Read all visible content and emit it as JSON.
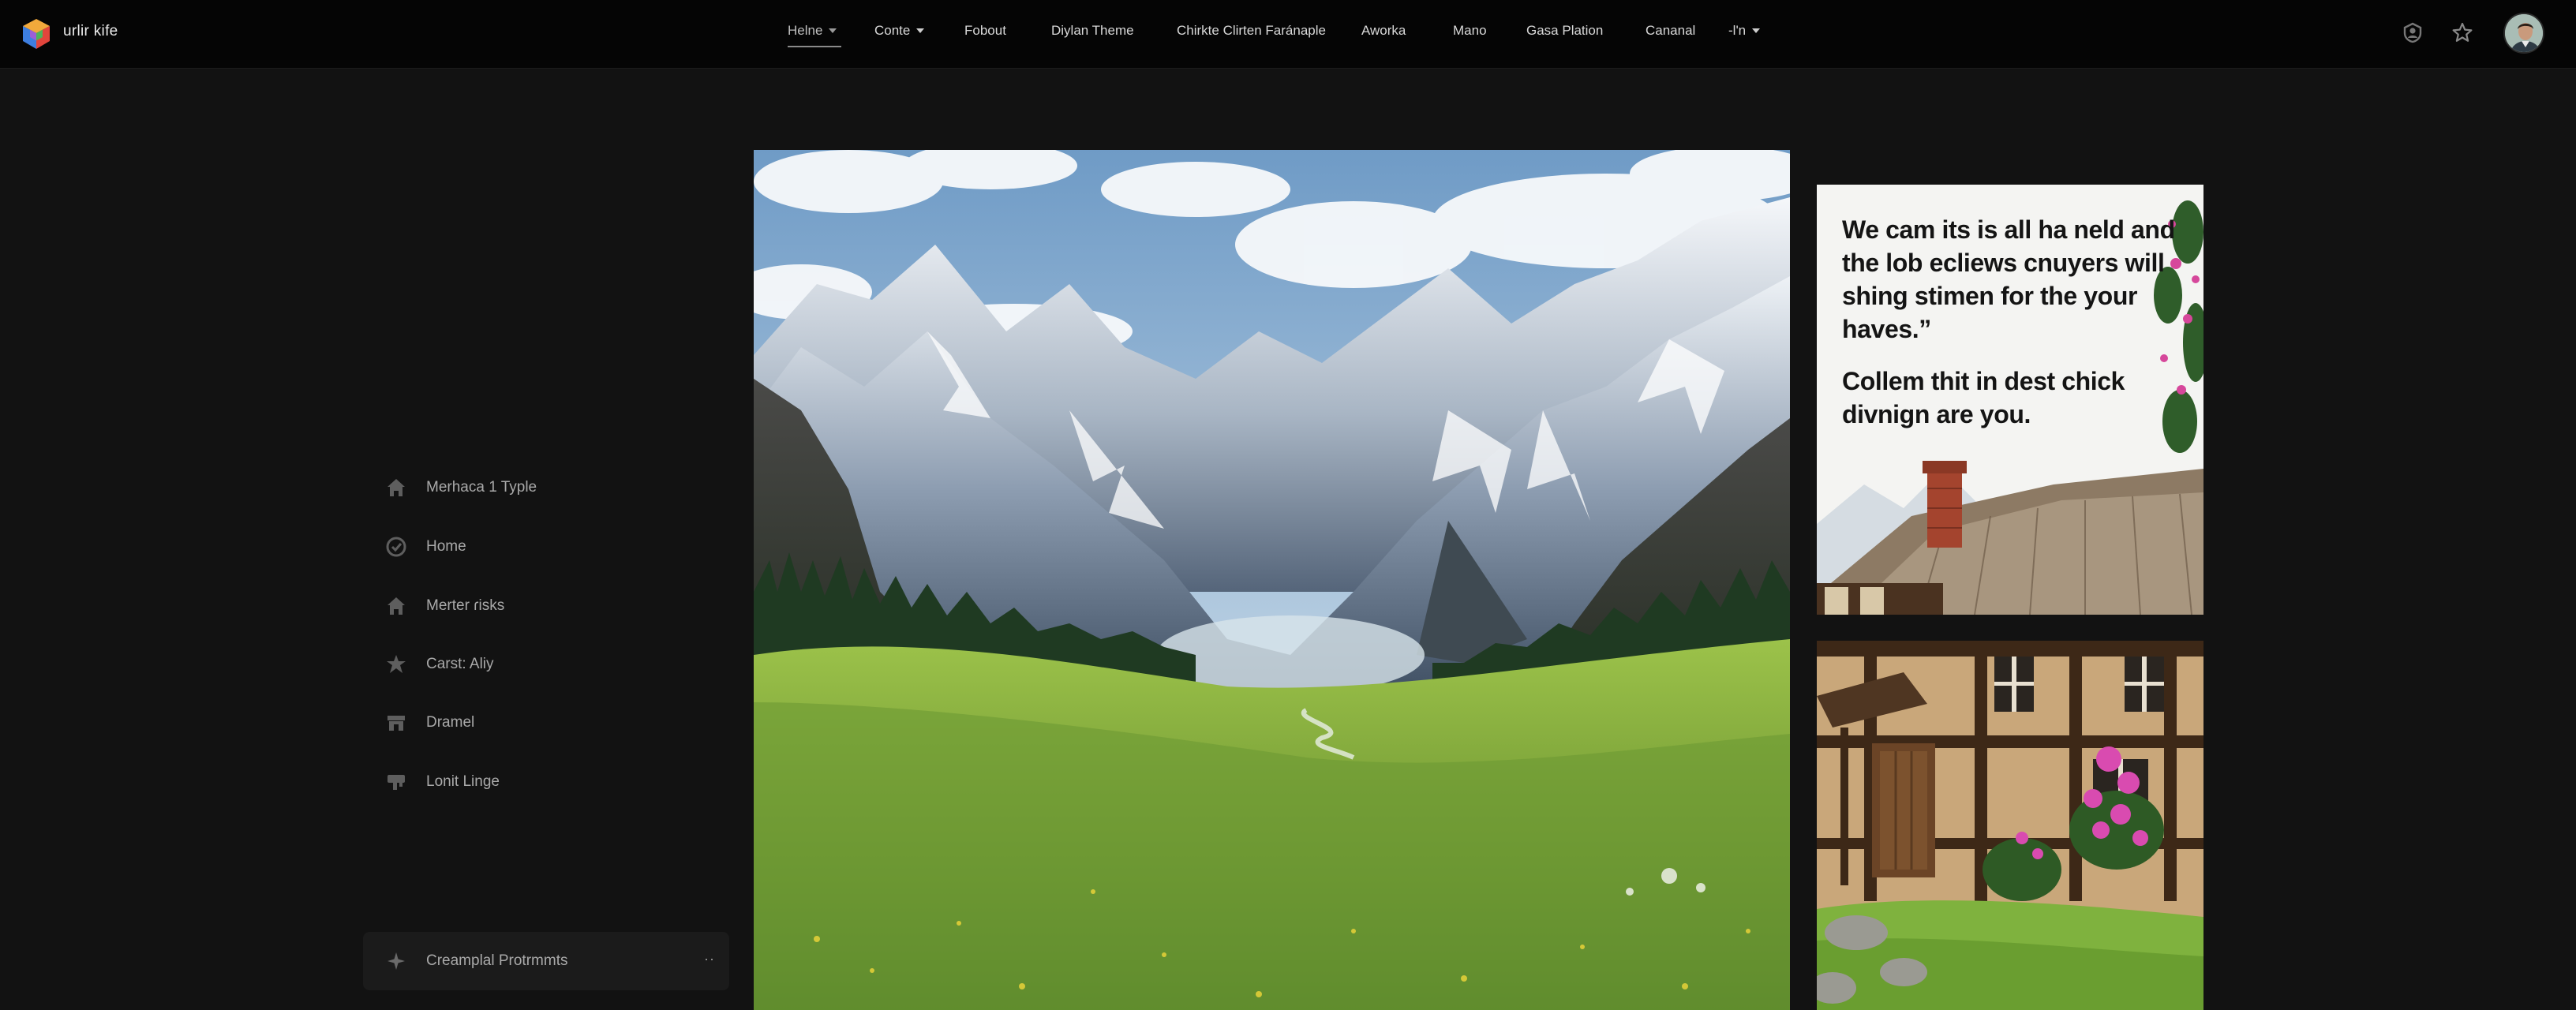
{
  "brand": {
    "name": "urlir kife"
  },
  "nav": {
    "items": [
      {
        "label": "Helne",
        "dropdown": true,
        "active": true
      },
      {
        "label": "Conte",
        "dropdown": true
      },
      {
        "label": "Fobout"
      },
      {
        "label": "Diylan Theme"
      },
      {
        "label": "Chirkte Clirten Faránaple"
      },
      {
        "label": "Aworka"
      },
      {
        "label": "Mano"
      },
      {
        "label": "Gasa Plation"
      },
      {
        "label": "Cananal"
      },
      {
        "label": "-l'n",
        "dropdown": true
      }
    ]
  },
  "top_icons": [
    "profile-badge-icon",
    "star-icon",
    "avatar"
  ],
  "sidebar": {
    "items": [
      {
        "label": "Merhaca 1 Typle",
        "icon": "home-icon"
      },
      {
        "label": "Home",
        "icon": "check-circle-icon"
      },
      {
        "label": "Merter ɾisks",
        "icon": "home-icon"
      },
      {
        "label": "Carst: Aliy",
        "icon": "star-burst-icon"
      },
      {
        "label": "Dramel",
        "icon": "store-icon"
      },
      {
        "label": "Lonit Linge",
        "icon": "thumbs-down-icon"
      }
    ],
    "bottom": {
      "label": "Creamplal Protrmmts",
      "icon": "sparkle-icon",
      "more": "··"
    }
  },
  "card_quote": {
    "line1": "We cam its is all ha neld and the lob ecliews cnuyers will shing stimen for the your haves.”",
    "line2": "Collem thit in dest chick divnign are you."
  },
  "colors": {
    "background": "#121212",
    "topbar": "#050505",
    "sidebar_text": "#a9a9a9"
  }
}
